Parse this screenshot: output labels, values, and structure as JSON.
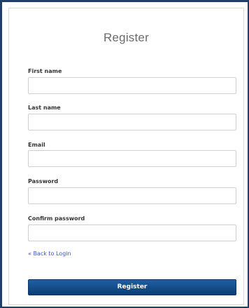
{
  "form": {
    "title": "Register",
    "fields": [
      {
        "label": "First name",
        "value": ""
      },
      {
        "label": "Last name",
        "value": ""
      },
      {
        "label": "Email",
        "value": ""
      },
      {
        "label": "Password",
        "value": ""
      },
      {
        "label": "Confirm password",
        "value": ""
      }
    ],
    "back_link": "« Back to Login",
    "submit_label": "Register"
  },
  "colors": {
    "frame_border": "#1f3f6a",
    "button_bg": "#0c3d74",
    "link": "#3a53c7",
    "title_text": "#6b6b6b"
  }
}
